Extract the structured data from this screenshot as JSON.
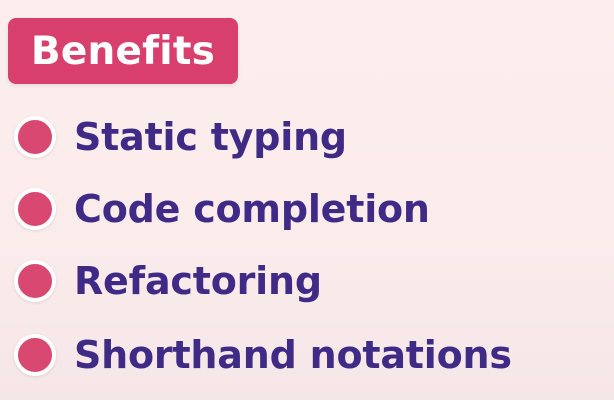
{
  "slide": {
    "title": "Benefits",
    "items": [
      {
        "label": "Static typing"
      },
      {
        "label": "Code completion"
      },
      {
        "label": "Refactoring"
      },
      {
        "label": "Shorthand notations"
      }
    ]
  },
  "colors": {
    "background": "#fbeceb",
    "badge": "#d93f6d",
    "bullet": "#d94870",
    "text": "#3f2a86"
  },
  "icons": {
    "bullet": "pink-circle-bullet"
  }
}
